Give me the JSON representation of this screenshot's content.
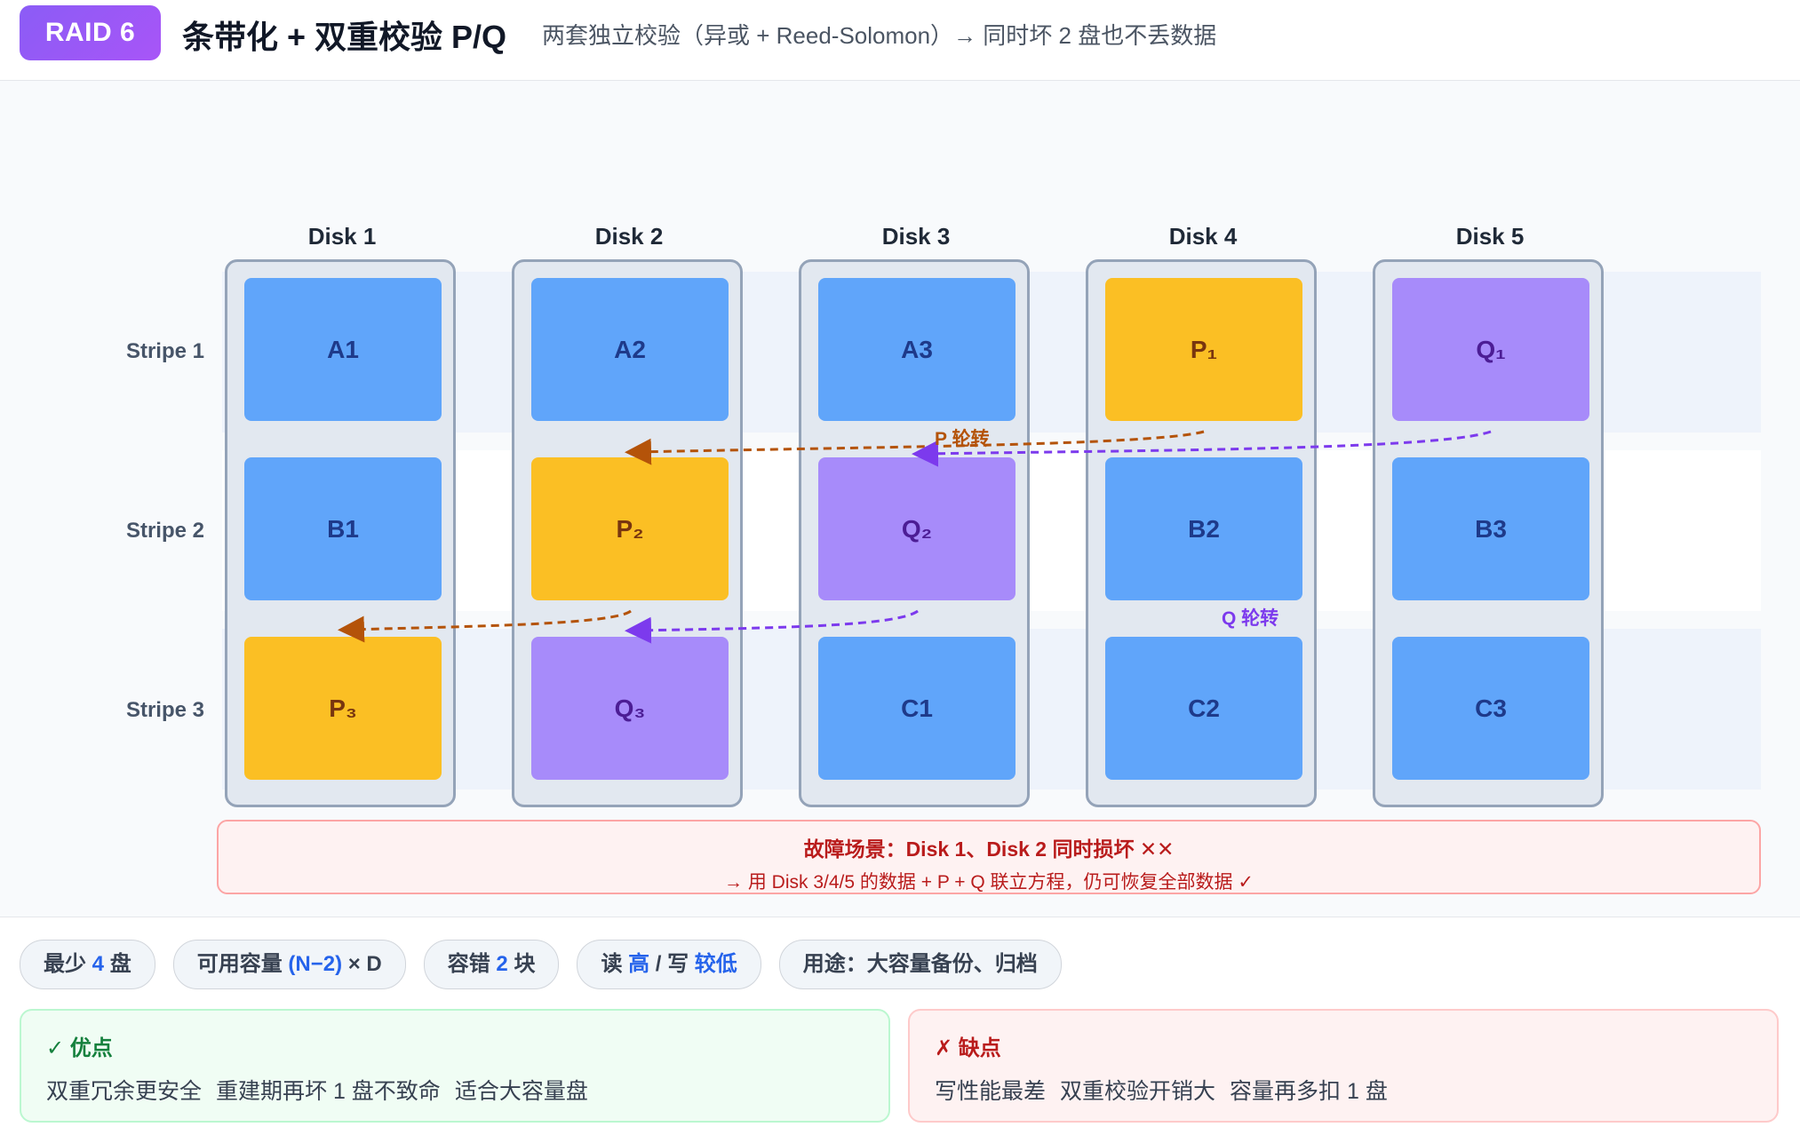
{
  "header": {
    "badge": "RAID 6",
    "title": "条带化 + 双重校验 P/Q",
    "subtitle": "两套独立校验（异或 + Reed-Solomon）→ 同时坏 2 盘也不丢数据"
  },
  "diagram": {
    "disks": [
      "Disk 1",
      "Disk 2",
      "Disk 3",
      "Disk 4",
      "Disk 5"
    ],
    "stripes": [
      "Stripe 1",
      "Stripe 2",
      "Stripe 3"
    ],
    "blocks": [
      [
        "A1",
        "A2",
        "A3",
        "P₁",
        "Q₁"
      ],
      [
        "B1",
        "P₂",
        "Q₂",
        "B2",
        "B3"
      ],
      [
        "P₃",
        "Q₃",
        "C1",
        "C2",
        "C3"
      ]
    ],
    "block_types": [
      [
        "data",
        "data",
        "data",
        "p",
        "q"
      ],
      [
        "data",
        "p",
        "q",
        "data",
        "data"
      ],
      [
        "p",
        "q",
        "data",
        "data",
        "data"
      ]
    ],
    "p_rotation_label": "P 轮转",
    "q_rotation_label": "Q 轮转",
    "colors": {
      "data": "#60a5fa",
      "p": "#fbbf24",
      "q": "#a78bfa",
      "p_arrow": "#b45309",
      "q_arrow": "#7c3aed"
    },
    "failure": {
      "title": "故障场景：Disk 1、Disk 2 同时损坏 ✕✕",
      "text": "→ 用 Disk 3/4/5 的数据 + P + Q 联立方程，仍可恢复全部数据 ✓"
    }
  },
  "chips": {
    "min": {
      "pre": "最少 ",
      "hl": "4",
      "post": " 盘"
    },
    "capacity": {
      "pre": "可用容量 ",
      "hl": "(N−2)",
      "post": " × D"
    },
    "fault": {
      "pre": "容错 ",
      "hl": "2",
      "post": " 块"
    },
    "rw": {
      "read_pre": "读 ",
      "read_hl": "高",
      "mid": " / 写 ",
      "write_hl": "较低"
    },
    "usage": "用途：大容量备份、归档"
  },
  "pros": {
    "title": "✓ 优点",
    "items": [
      "双重冗余更安全",
      "重建期再坏 1 盘不致命",
      "适合大容量盘"
    ]
  },
  "cons": {
    "title": "✗ 缺点",
    "items": [
      "写性能最差",
      "双重校验开销大",
      "容量再多扣 1 盘"
    ]
  }
}
